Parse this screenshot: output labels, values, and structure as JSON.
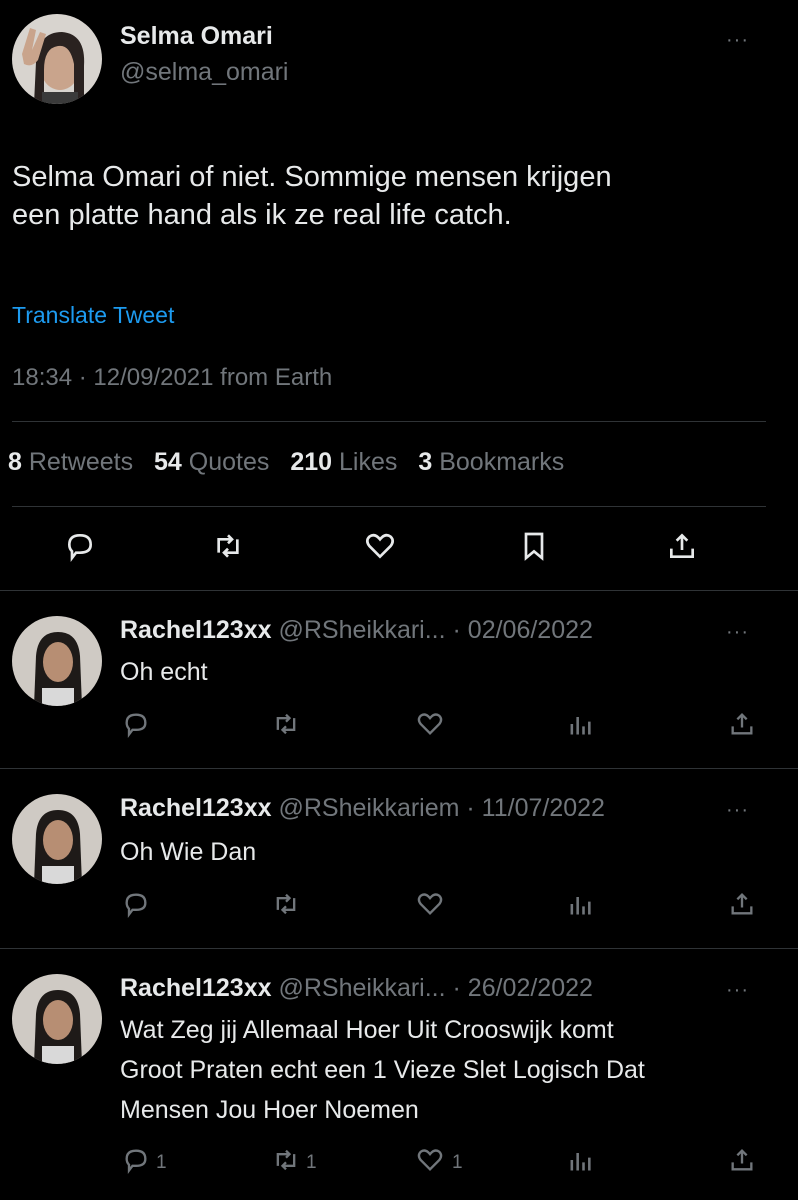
{
  "main_tweet": {
    "author_name": "Selma Omari",
    "author_handle": "@selma_omari",
    "text_line1": "Selma Omari of niet. Sommige mensen krijgen",
    "text_line2": "een platte hand als ik ze real life catch.",
    "translate_label": "Translate Tweet",
    "meta": "18:34 · 12/09/2021 from Earth",
    "stats": {
      "retweets_num": "8",
      "retweets_label": "Retweets",
      "quotes_num": "54",
      "quotes_label": "Quotes",
      "likes_num": "210",
      "likes_label": "Likes",
      "bookmarks_num": "3",
      "bookmarks_label": "Bookmarks"
    },
    "actions": [
      "reply-icon",
      "retweet-icon",
      "like-icon",
      "bookmark-icon",
      "share-icon"
    ]
  },
  "replies": [
    {
      "name": "Rachel123xx",
      "handle": "@RSheikkari...",
      "date": "· 02/06/2022",
      "text": "Oh echt",
      "counts": {
        "reply": "",
        "retweet": "",
        "like": ""
      }
    },
    {
      "name": "Rachel123xx",
      "handle": "@RSheikkariem",
      "date": "· 11/07/2022",
      "text": "Oh Wie Dan",
      "counts": {
        "reply": "",
        "retweet": "",
        "like": ""
      }
    },
    {
      "name": "Rachel123xx",
      "handle": "@RSheikkari...",
      "date": "· 26/02/2022",
      "text_line1": "Wat Zeg jij Allemaal Hoer Uit Crooswijk komt",
      "text_line2": "Groot Praten echt een 1 Vieze Slet Logisch Dat",
      "text_line3": "Mensen Jou Hoer Noemen",
      "counts": {
        "reply": "1",
        "retweet": "1",
        "like": "1"
      }
    }
  ],
  "colors": {
    "background": "#000000",
    "text": "#e7e9ea",
    "muted": "#71767b",
    "link": "#1d9bf0",
    "divider": "#2f3336"
  },
  "more_label": "···"
}
